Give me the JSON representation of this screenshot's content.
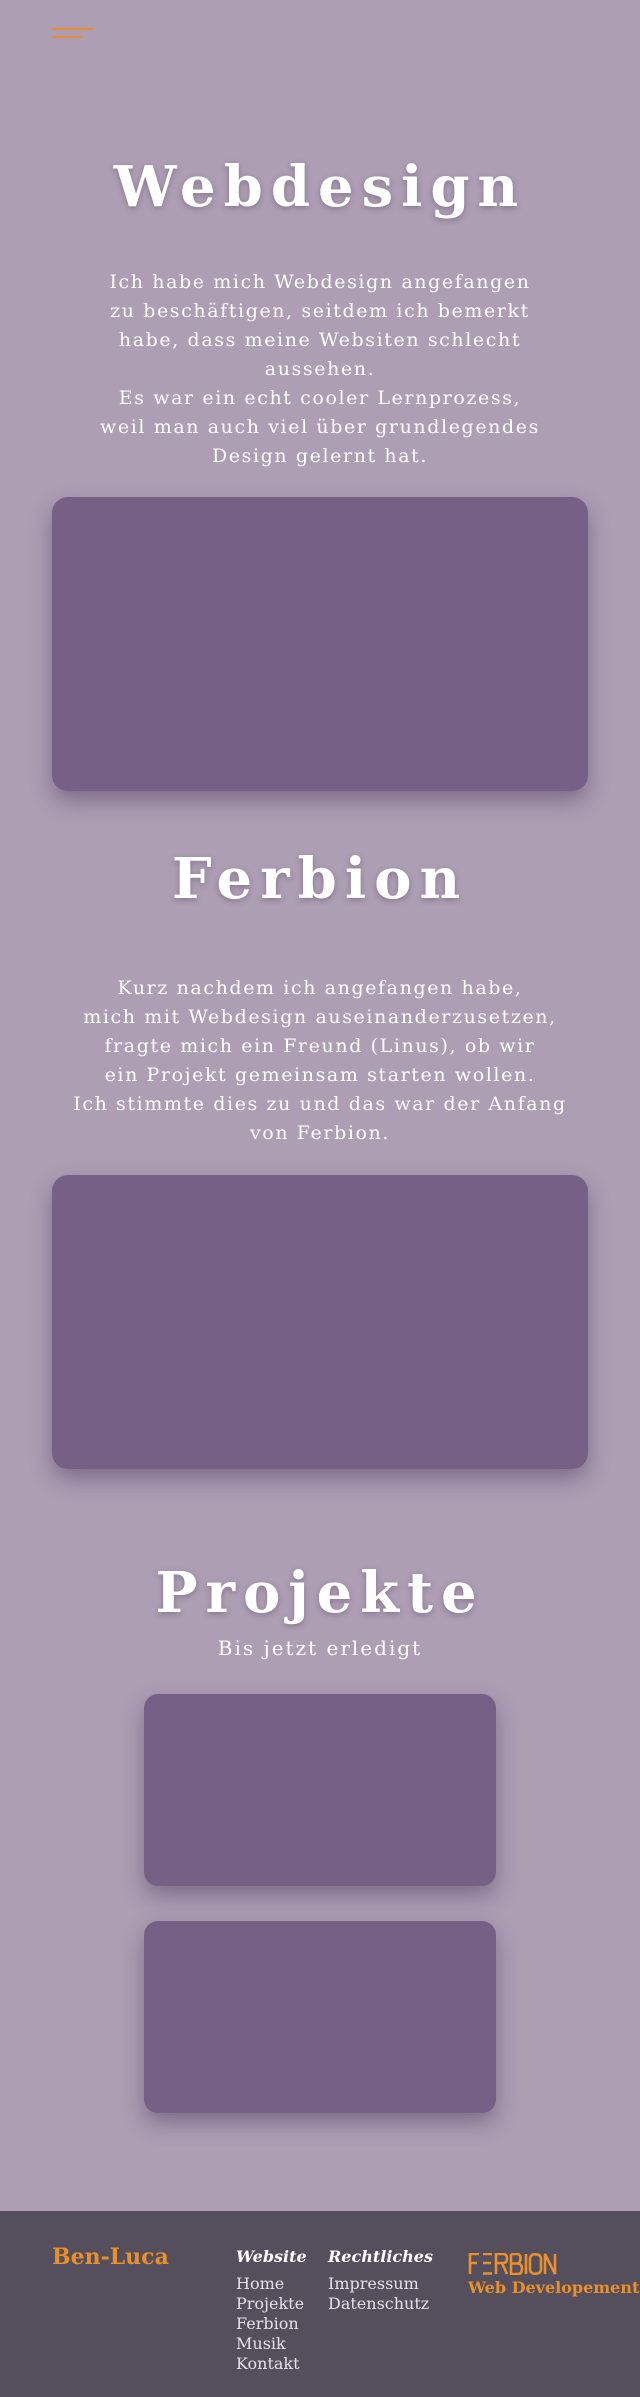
{
  "nav": {
    "menu_icon": "hamburger-menu-icon"
  },
  "webdesign": {
    "title": "Webdesign",
    "lines": [
      "Ich habe mich Webdesign angefangen",
      "zu beschäftigen, seitdem ich bemerkt",
      "habe, dass meine Websiten schlecht",
      "aussehen.",
      "Es war ein echt cooler Lernprozess,",
      "weil man auch viel über grundlegendes",
      "Design gelernt hat."
    ]
  },
  "ferbion": {
    "title": "Ferbion",
    "lines": [
      "Kurz nachdem ich angefangen habe,",
      "mich mit Webdesign auseinanderzusetzen,",
      "fragte mich ein Freund (Linus), ob wir",
      "ein Projekt gemeinsam starten wollen.",
      "Ich stimmte dies zu und das war der Anfang",
      "von Ferbion."
    ]
  },
  "projekte": {
    "title": "Projekte",
    "subtitle": "Bis jetzt erledigt"
  },
  "footer": {
    "brand": "Ben-Luca",
    "website": {
      "heading": "Website",
      "links": [
        "Home",
        "Projekte",
        "Ferbion",
        "Musik",
        "Kontakt"
      ]
    },
    "legal": {
      "heading": "Rechtliches",
      "links": [
        "Impressum",
        "Datenschutz"
      ]
    },
    "logo_text": "FERBION",
    "tagline": "Web Developement"
  },
  "colors": {
    "background": "#ad9eb4",
    "card": "#776086",
    "accent": "#e8902b",
    "footer": "#554e5d"
  }
}
